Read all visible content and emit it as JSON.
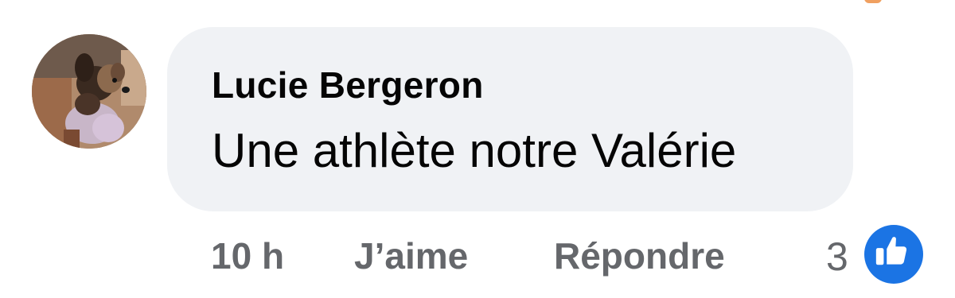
{
  "comment": {
    "author": "Lucie Bergeron",
    "text": "Une athlète notre Valérie",
    "timestamp": "10 h",
    "like_label": "J’aime",
    "reply_label": "Répondre",
    "reaction_count": "3",
    "reaction_icon": "thumbs-up-icon"
  },
  "colors": {
    "bubble_background": "#f0f2f5",
    "text_primary": "#050505",
    "text_secondary": "#65676b",
    "like_blue": "#1b74e4"
  }
}
